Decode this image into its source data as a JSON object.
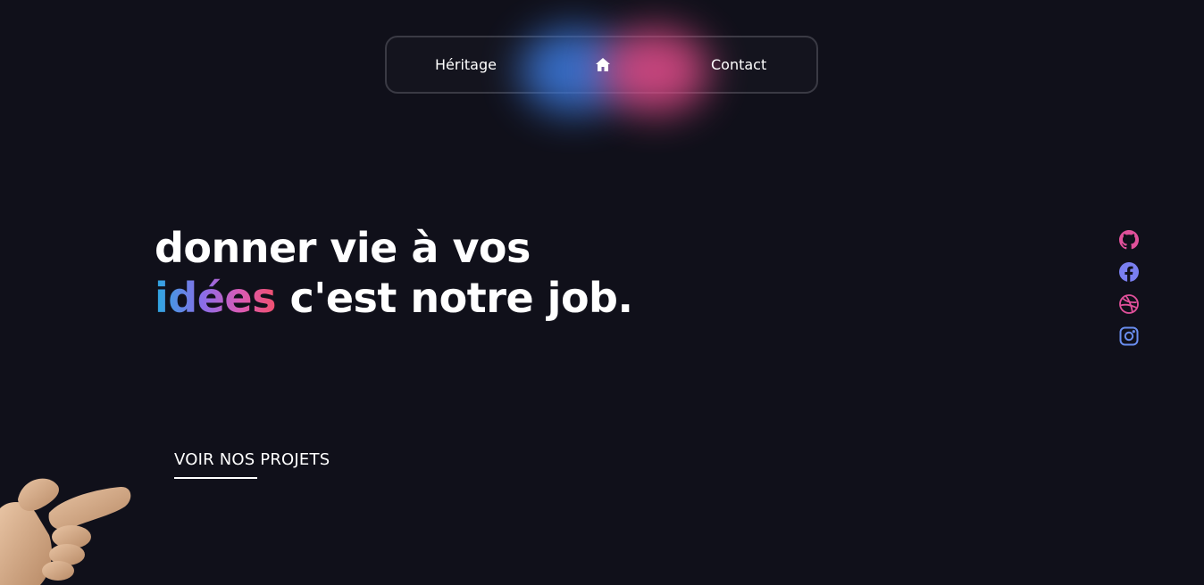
{
  "nav": {
    "left_label": "Héritage",
    "home_icon": "home-icon",
    "right_label": "Contact"
  },
  "hero": {
    "line1": "donner vie à vos",
    "highlight": "idées",
    "line2_rest": " c'est notre job."
  },
  "cta": {
    "label": "VOIR NOS PROJETS"
  },
  "social": [
    {
      "icon": "github-icon",
      "color": "#e0509a"
    },
    {
      "icon": "facebook-icon",
      "color": "#7a7ff0"
    },
    {
      "icon": "dribbble-icon",
      "color": "#e0509a"
    },
    {
      "icon": "instagram-icon",
      "color": "#6a8ef0"
    }
  ],
  "colors": {
    "background": "#10101a",
    "gradient_start": "#2aa8e0",
    "gradient_mid": "#8b6de8",
    "gradient_end": "#f0506e",
    "nav_border": "#3a3a44"
  }
}
